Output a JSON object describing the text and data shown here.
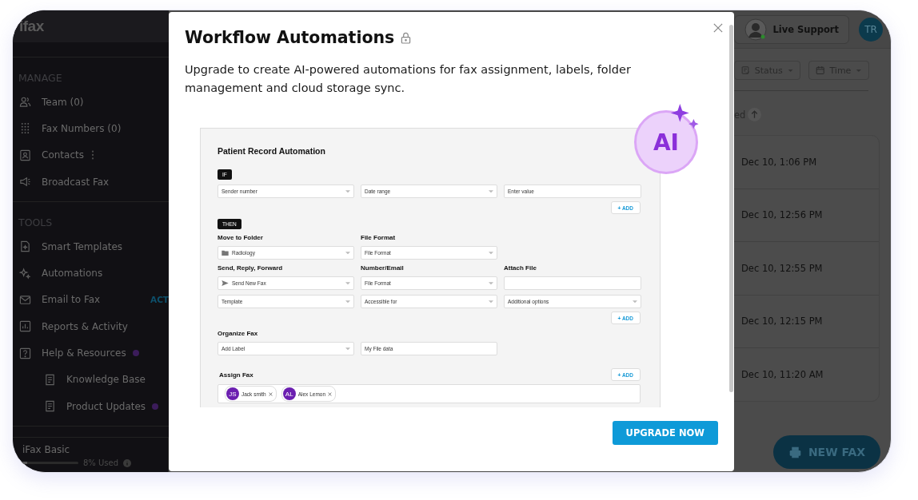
{
  "sidebar": {
    "logo": "ifax",
    "sections": [
      {
        "heading": "MANAGE",
        "items": [
          {
            "label": "Team (0)"
          },
          {
            "label": "Fax Numbers (0)"
          },
          {
            "label": "Contacts",
            "menu": true
          },
          {
            "label": "Broadcast Fax"
          }
        ]
      },
      {
        "heading": "TOOLS",
        "items": [
          {
            "label": "Smart Templates"
          },
          {
            "label": "Automations"
          },
          {
            "label": "Email to Fax",
            "tag": "ACT"
          },
          {
            "label": "Reports & Activity"
          },
          {
            "label": "Help & Resources",
            "unread": true,
            "children": [
              {
                "label": "Knowledge Base"
              },
              {
                "label": "Product Updates",
                "unread": true
              }
            ]
          }
        ]
      }
    ],
    "plan": {
      "name": "iFax Basic",
      "level": 0.08,
      "reading": "8% Used"
    }
  },
  "topbar": {
    "support": "Live Support",
    "avatar": "TR"
  },
  "filters": [
    {
      "label": "Status"
    },
    {
      "label": "Time"
    }
  ],
  "sort": {
    "label": "ed"
  },
  "faxes": [
    {
      "time": "Dec 10, 1:06 PM"
    },
    {
      "time": "Dec 10, 12:56 PM"
    },
    {
      "time": "Dec 10, 12:55 PM"
    },
    {
      "time": "Dec 10, 12:15 PM"
    },
    {
      "time": "Dec 10, 11:20 AM"
    }
  ],
  "new_fax": "NEW FAX",
  "modal": {
    "title": "Workflow Automations",
    "locked": true,
    "description": "Upgrade to create AI-powered automations for fax assignment, labels, folder management and cloud storage sync.",
    "badge": "AI",
    "automation": {
      "title": "Patient Record Automation",
      "blocks": [
        {
          "kind": "tag",
          "text": "IF"
        },
        {
          "kind": "fields",
          "fields": [
            {
              "kind": "select",
              "text": "Sender number"
            },
            {
              "kind": "select",
              "text": "Date range"
            },
            {
              "kind": "input",
              "text": "Enter value"
            }
          ]
        },
        {
          "kind": "add",
          "text": "+ ADD"
        },
        {
          "kind": "tag",
          "text": "THEN"
        },
        {
          "kind": "labels",
          "labels": [
            "Move to Folder",
            "File Format"
          ]
        },
        {
          "kind": "fields",
          "fields": [
            {
              "kind": "folder",
              "text": "Radiology"
            },
            {
              "kind": "select",
              "text": "File Format"
            }
          ]
        },
        {
          "kind": "labels",
          "labels": [
            "Send, Reply, Forward",
            "Number/Email",
            "Attach File"
          ]
        },
        {
          "kind": "fields",
          "fields": [
            {
              "kind": "send",
              "text": "Send New Fax"
            },
            {
              "kind": "select",
              "text": "File Format"
            },
            {
              "kind": "input"
            }
          ]
        },
        {
          "kind": "fields",
          "fields": [
            {
              "kind": "select",
              "text": "Template"
            },
            {
              "kind": "select",
              "text": "Accessible for"
            },
            {
              "kind": "select",
              "text": "Additional options"
            }
          ]
        },
        {
          "kind": "add",
          "text": "+ ADD"
        },
        {
          "kind": "labels",
          "labels": [
            "Organize Fax"
          ]
        },
        {
          "kind": "fields",
          "fields": [
            {
              "kind": "select",
              "text": "Add Label"
            },
            {
              "kind": "input",
              "text": "My File data"
            }
          ]
        },
        {
          "kind": "assign",
          "label": "Assign Fax",
          "add": "+ ADD",
          "people": [
            {
              "initials": "JS",
              "name": "Jack smith"
            },
            {
              "initials": "AL",
              "name": "Alex Lemon"
            }
          ]
        }
      ]
    },
    "button": "UPGRADE NOW"
  }
}
